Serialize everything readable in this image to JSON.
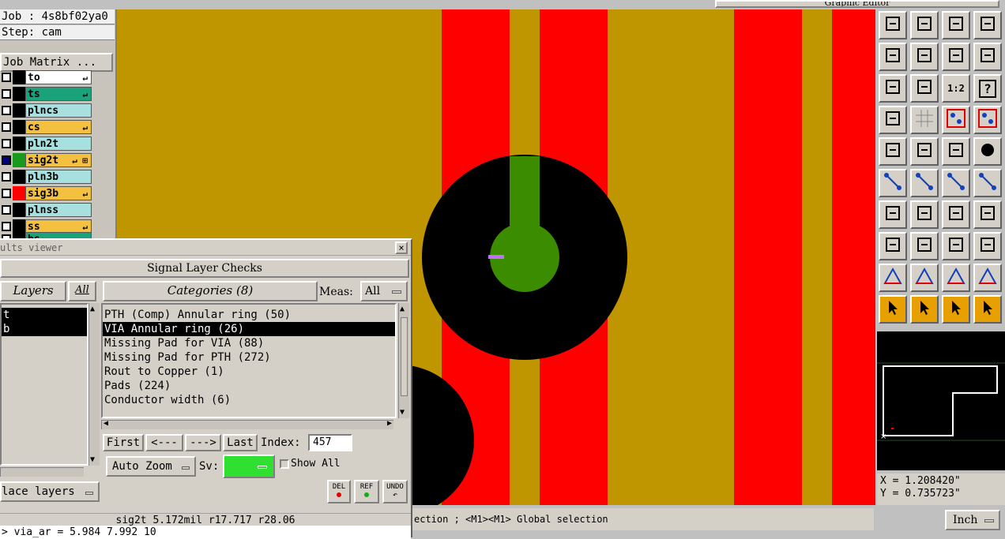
{
  "graphic_editor": {
    "title": "Graphic Editor"
  },
  "job_panel": {
    "job_line": "Job : 4s8bf02ya0",
    "step_line": "Step: cam",
    "job_matrix_button": "Job Matrix ..."
  },
  "layers": [
    {
      "name": "to",
      "color": "#ffffff",
      "swatch": "#000000",
      "flag": "↵"
    },
    {
      "name": "ts",
      "color": "#1aa37a",
      "swatch": "#000000",
      "flag": "↵"
    },
    {
      "name": "plncs",
      "color": "#a8e0e0",
      "swatch": "#000000",
      "flag": ""
    },
    {
      "name": "cs",
      "color": "#f4c040",
      "swatch": "#000000",
      "flag": "↵"
    },
    {
      "name": "pln2t",
      "color": "#a8e0e0",
      "swatch": "#000000",
      "flag": ""
    },
    {
      "name": "sig2t",
      "color": "#f4c040",
      "swatch": "#1a9a1a",
      "flag": "↵ ⊞"
    },
    {
      "name": "pln3b",
      "color": "#a8e0e0",
      "swatch": "#000000",
      "flag": ""
    },
    {
      "name": "sig3b",
      "color": "#f4c040",
      "swatch": "#ff0000",
      "flag": "↵"
    },
    {
      "name": "plnss",
      "color": "#a8e0e0",
      "swatch": "#000000",
      "flag": ""
    },
    {
      "name": "ss",
      "color": "#f4c040",
      "swatch": "#000000",
      "flag": "↵"
    },
    {
      "name": "bs",
      "color": "#1aa37a",
      "swatch": "#000000",
      "flag": ""
    }
  ],
  "results_viewer": {
    "title": "ults viewer",
    "check_title": "Signal Layer Checks",
    "layers_header": "Layers",
    "all_button": "All",
    "categories_header": "Categories (8)",
    "meas_label": "Meas:",
    "meas_value": "All",
    "layer_items": [
      "t",
      "b"
    ],
    "categories": [
      {
        "label": "PTH (Comp) Annular ring (50)",
        "selected": false
      },
      {
        "label": "VIA Annular ring (26)",
        "selected": true
      },
      {
        "label": "Missing Pad for VIA (88)",
        "selected": false
      },
      {
        "label": "Missing Pad for PTH (272)",
        "selected": false
      },
      {
        "label": "Rout to Copper (1)",
        "selected": false
      },
      {
        "label": "Pads (224)",
        "selected": false
      },
      {
        "label": "Conductor width (6)",
        "selected": false
      }
    ],
    "nav": {
      "first": "First",
      "prev": "<---",
      "next": "--->",
      "last": "Last",
      "index_label": "Index:",
      "index_value": "457"
    },
    "auto_zoom": "Auto Zoom",
    "sv_label": "Sv:",
    "show_all": "Show All",
    "replace_layers": "lace layers",
    "del": "DEL",
    "ref": "REF",
    "undo": "UNDO",
    "info_line": "sig2t  5.172mil   r17.717   r28.06",
    "cmd_line": "> via_ar = 5.984 7.992 10"
  },
  "status_bar": {
    "text": "ection ; <M1><M1> Global selection"
  },
  "coords": {
    "x": "X = 1.208420\"",
    "y": "Y = 0.735723\""
  },
  "unit": "Inch",
  "tool_labels": {
    "ratio": "1:2",
    "help": "?"
  },
  "colors": {
    "canvas": "#bf9500",
    "red_trace": "#ff0000",
    "green_trace": "#3c8c00",
    "pad": "#000000",
    "active_tool": "#e8a000"
  }
}
